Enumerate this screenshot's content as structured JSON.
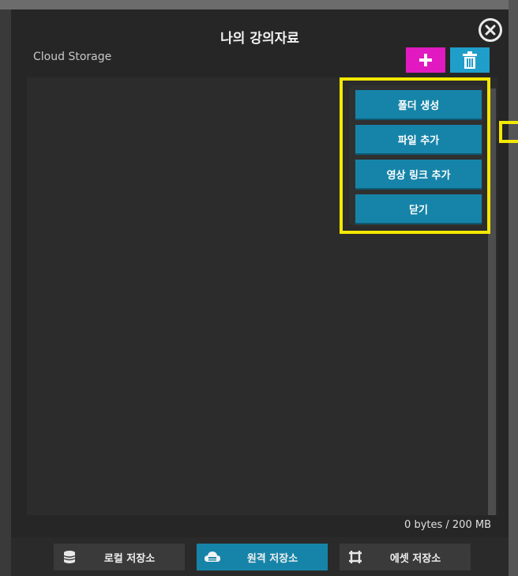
{
  "dialog": {
    "title": "나의 강의자료",
    "storage_label": "Cloud Storage",
    "storage_size": "0 bytes / 200 MB"
  },
  "toolbar": {
    "add_icon": "plus-icon",
    "delete_icon": "trash-icon",
    "add_color": "#e01ac0",
    "delete_color": "#1f9ec9"
  },
  "menu": {
    "items": [
      {
        "label": "폴더 생성"
      },
      {
        "label": "파일 추가"
      },
      {
        "label": "영상 링크 추가"
      },
      {
        "label": "닫기"
      }
    ],
    "highlight_color": "#f5e800",
    "button_color": "#1684a8"
  },
  "footer": {
    "tabs": [
      {
        "label": "로컬 저장소",
        "icon": "database-icon",
        "active": false
      },
      {
        "label": "원격 저장소",
        "icon": "cloud-icon",
        "active": true
      },
      {
        "label": "에셋 저장소",
        "icon": "asset-frame-icon",
        "active": false
      }
    ]
  }
}
